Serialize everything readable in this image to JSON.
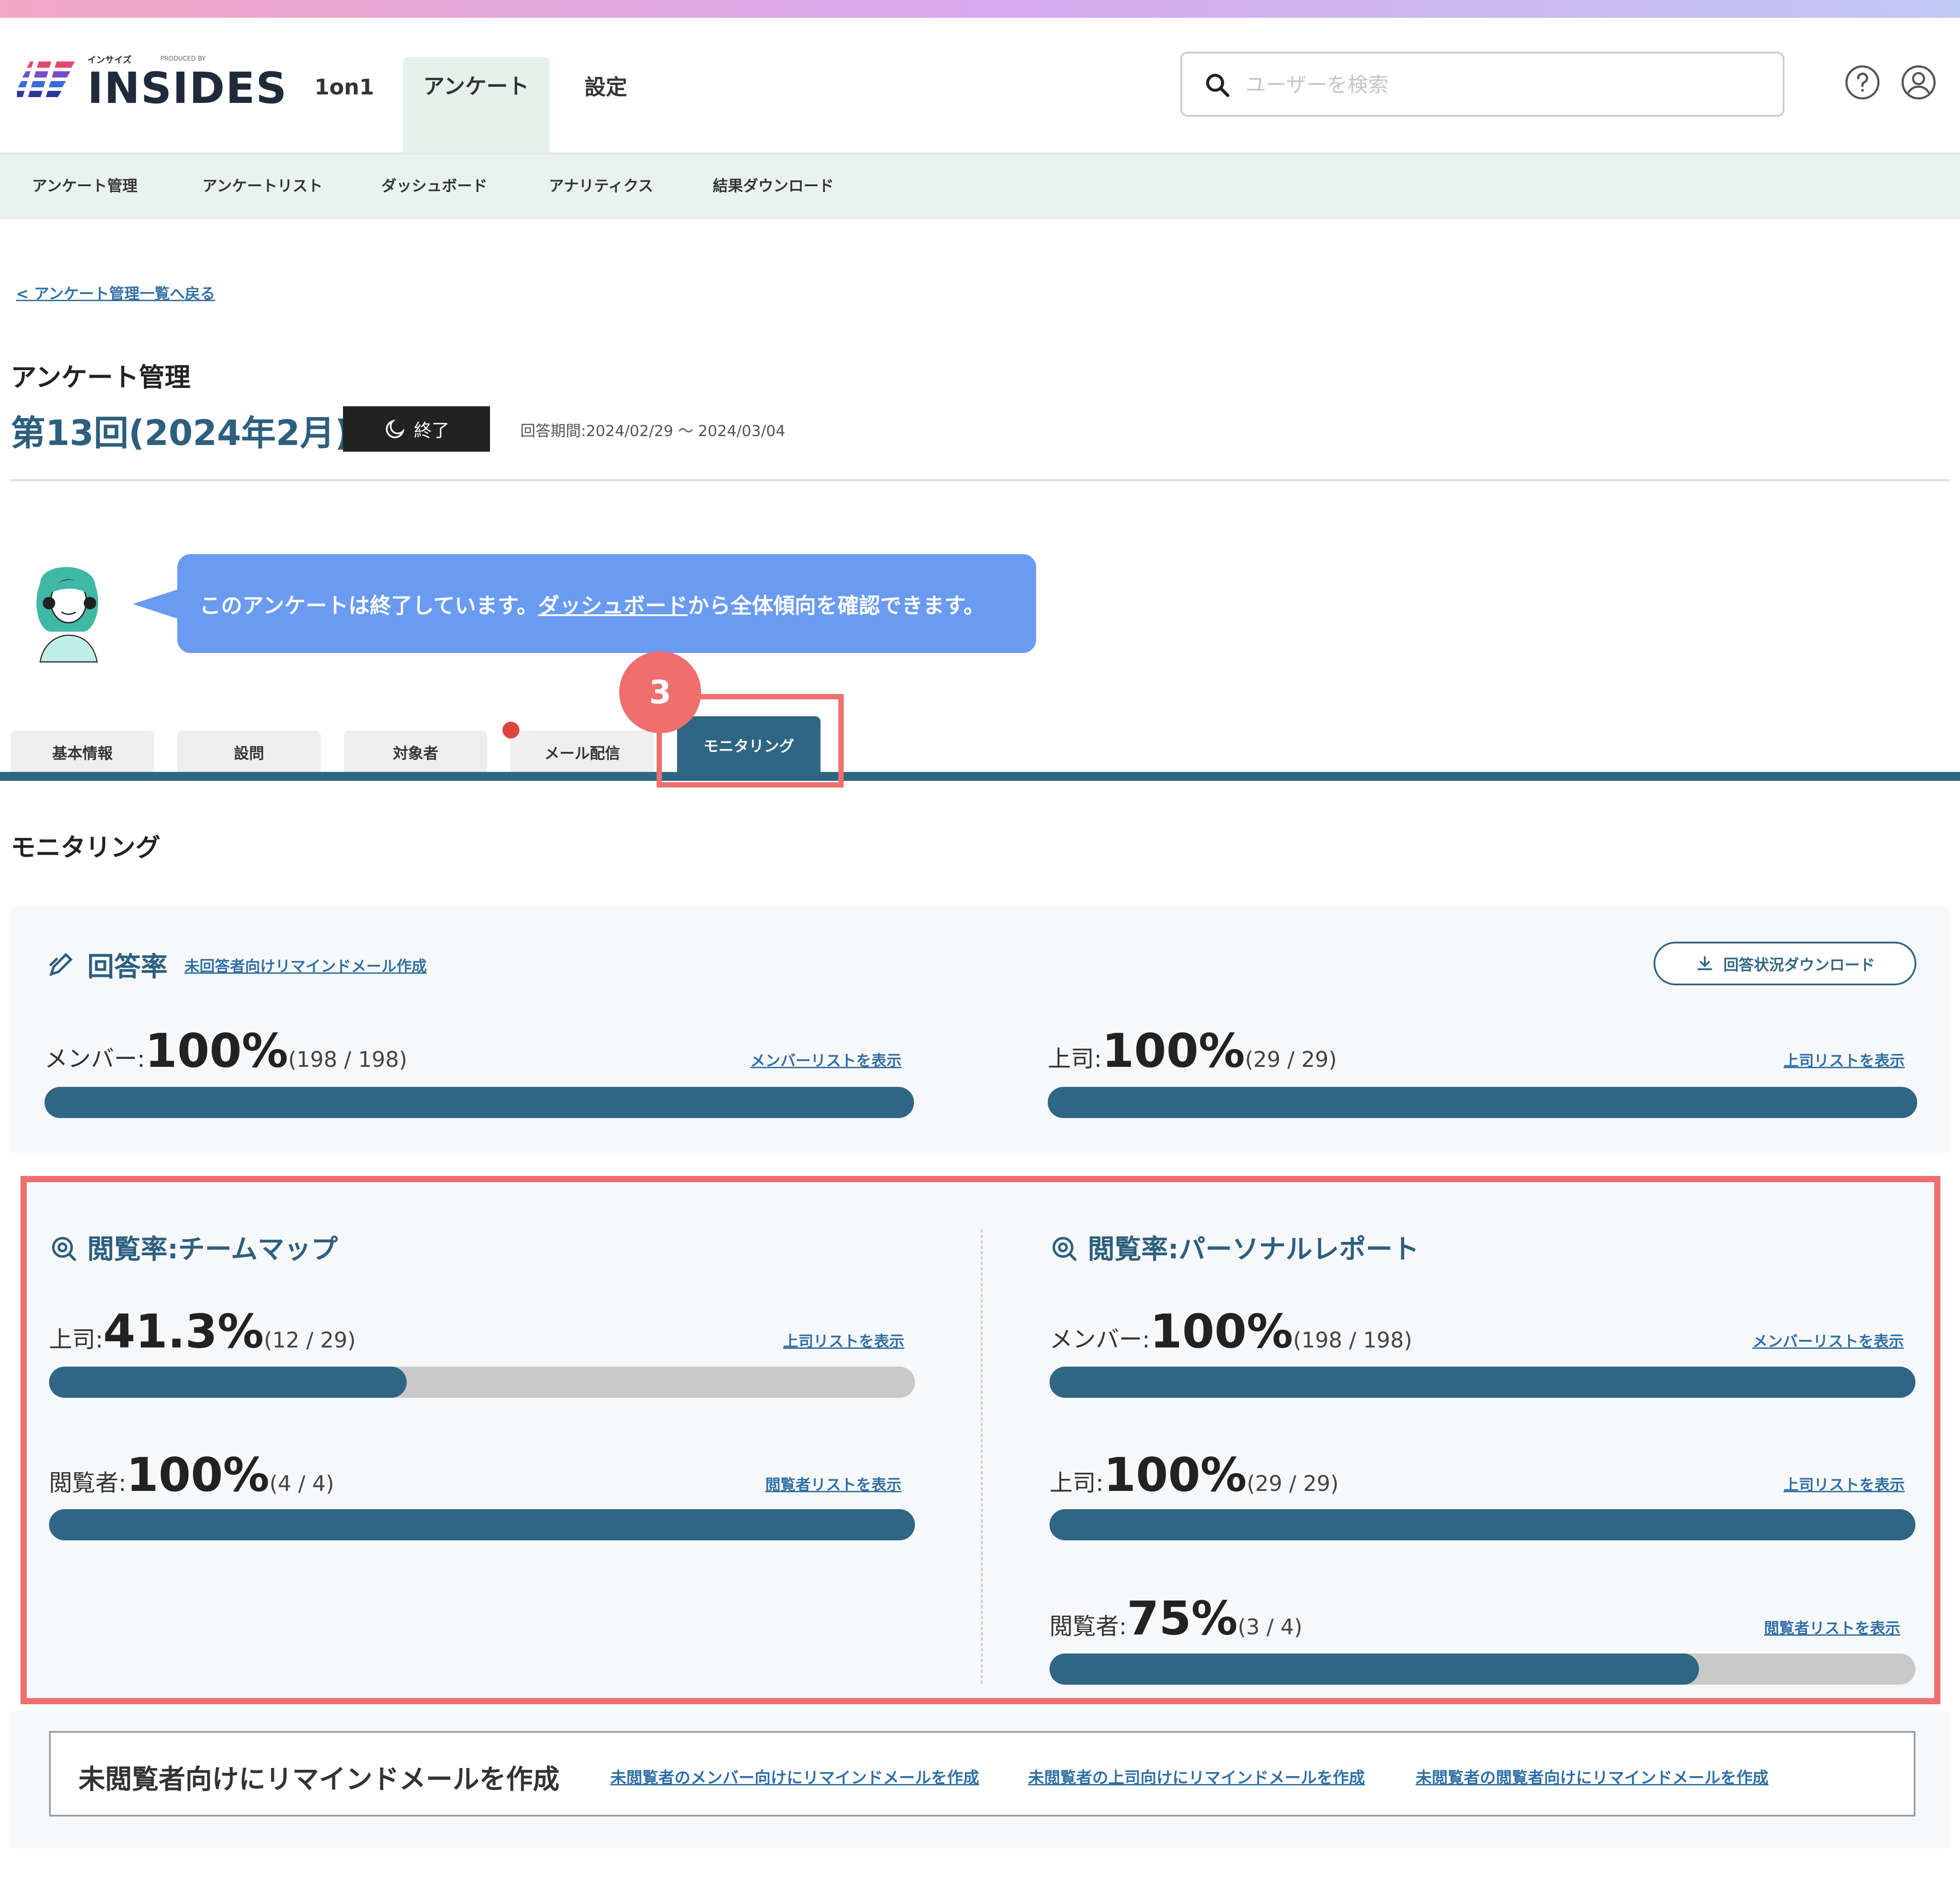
{
  "header": {
    "logo_text": "INSIDES",
    "logo_small": "インサイズ",
    "logo_produced": "PRODUCED BY",
    "nav": [
      "1on1",
      "アンケート",
      "設定"
    ],
    "search_placeholder": "ユーザーを検索",
    "help_icon": "question-circle-icon",
    "account_icon": "user-circle-icon"
  },
  "subnav": [
    "アンケート管理",
    "アンケートリスト",
    "ダッシュボード",
    "アナリティクス",
    "結果ダウンロード"
  ],
  "breadcrumb": {
    "back_label": "< アンケート管理一覧へ戻る"
  },
  "page": {
    "section_title": "アンケート管理",
    "survey_name": "第13回(2024年2月)",
    "status_label": "終了",
    "period": "回答期間:2024/02/29 ～ 2024/03/04"
  },
  "bubble": {
    "text_before": "このアンケートは終了しています。",
    "link": "ダッシュボード",
    "text_after": "から全体傾向を確認できます。"
  },
  "tabs": [
    "基本情報",
    "設問",
    "対象者",
    "メール配信",
    "モニタリング"
  ],
  "callout_number": "3",
  "monitoring": {
    "title": "モニタリング",
    "response": {
      "title": "回答率",
      "remind_link": "未回答者向けリマインドメール作成",
      "download_label": "回答状況ダウンロード",
      "member": {
        "label": "メンバー:",
        "value": "100%",
        "count": "(198 / 198)",
        "link": "メンバーリストを表示",
        "fraction": 1.0
      },
      "boss": {
        "label": "上司:",
        "value": "100%",
        "count": "(29 / 29)",
        "link": "上司リストを表示",
        "fraction": 1.0
      }
    },
    "teammap": {
      "title": "閲覧率:チームマップ",
      "boss": {
        "label": "上司:",
        "value": "41.3%",
        "count": "(12 / 29)",
        "link": "上司リストを表示",
        "fraction": 0.413
      },
      "viewer": {
        "label": "閲覧者:",
        "value": "100%",
        "count": "(4 / 4)",
        "link": "閲覧者リストを表示",
        "fraction": 1.0
      }
    },
    "personal": {
      "title": "閲覧率:パーソナルレポート",
      "member": {
        "label": "メンバー:",
        "value": "100%",
        "count": "(198 / 198)",
        "link": "メンバーリストを表示",
        "fraction": 1.0
      },
      "boss": {
        "label": "上司:",
        "value": "100%",
        "count": "(29 / 29)",
        "link": "上司リストを表示",
        "fraction": 1.0
      },
      "viewer": {
        "label": "閲覧者:",
        "value": "75%",
        "count": "(3 / 4)",
        "link": "閲覧者リストを表示",
        "fraction": 0.75
      }
    },
    "remind": {
      "title": "未閲覧者向けにリマインドメールを作成",
      "links": [
        "未閲覧者のメンバー向けにリマインドメールを作成",
        "未閲覧者の上司向けにリマインドメールを作成",
        "未閲覧者の閲覧者向けにリマインドメールを作成"
      ]
    }
  },
  "colors": {
    "primary": "#2f6683",
    "accent_red": "#ef6f6f",
    "bubble": "#6a9bf0",
    "subnav_bg": "#e8f2ee"
  }
}
